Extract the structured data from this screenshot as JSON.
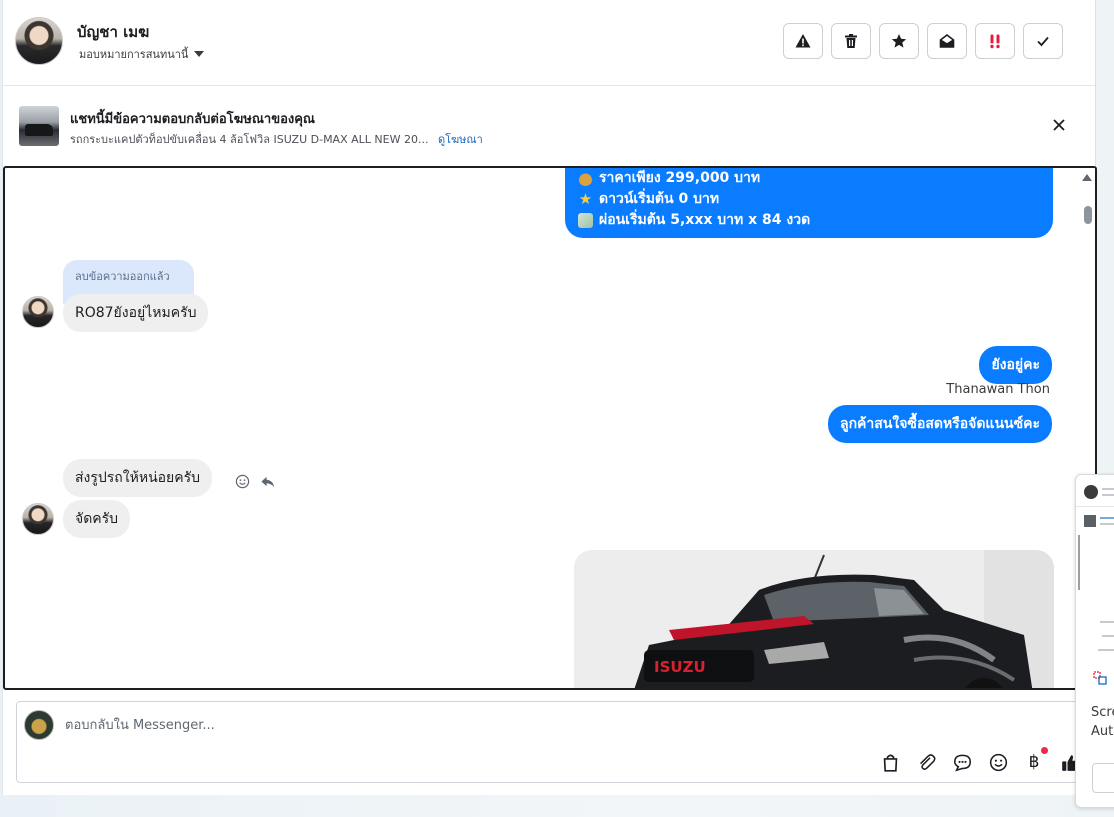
{
  "header": {
    "user_name": "บัญชา เมฆ",
    "assign_label": "มอบหมายการสนทนานี้",
    "actions": [
      {
        "name": "spam-icon",
        "label": "warning"
      },
      {
        "name": "trash-icon",
        "label": "delete"
      },
      {
        "name": "star-icon",
        "label": "star"
      },
      {
        "name": "mark-unread-icon",
        "label": "unread"
      },
      {
        "name": "important-icon",
        "label": "important",
        "color": "#e41e3f"
      },
      {
        "name": "check-icon",
        "label": "done"
      }
    ]
  },
  "ad_banner": {
    "title": "แชทนี้มีข้อความตอบกลับต่อโฆษณาของคุณ",
    "description": "รถกระบะแคปตัวท็อปขับเคลื่อน 4 ล้อโฟวิล ISUZU D-MAX ALL NEW 20...",
    "link_label": "ดูโฆษณา"
  },
  "messages": {
    "price_lines": [
      {
        "icon": "money-bag-icon",
        "text": "ราคาเพียง 299,000 บาท"
      },
      {
        "icon": "star-icon",
        "text": "ดาวน์เริ่มต้น 0 บาท"
      },
      {
        "icon": "money-wings-icon",
        "text": "ผ่อนเริ่มต้น 5,xxx บาท x 84 งวด"
      }
    ],
    "deleted_label": "ลบข้อความออกแล้ว",
    "in_1": "RO87ยังอยู่ไหมครับ",
    "out_1": "ยังอยู่คะ",
    "sender_name": "Thanawan Thon",
    "out_2": "ลูกค้าสนใจซื้อสดหรือจัดแนนซ์คะ",
    "in_2": "ส่งรูปรถให้หน่อยครับ",
    "in_3": "จัดครับ",
    "car_badge": "ISUZU"
  },
  "composer": {
    "placeholder": "ตอบกลับใน Messenger...",
    "tools": [
      "bag-icon",
      "attachment-icon",
      "saved-reply-icon",
      "emoji-icon",
      "baht-icon",
      "like-icon"
    ]
  },
  "preview_card": {
    "lines": [
      "Scre",
      "Aut"
    ]
  },
  "colors": {
    "accent": "#0a7cff",
    "deleted_bg": "#dbe7fb",
    "incoming_bg": "#efefef",
    "link": "#1a66c2"
  }
}
